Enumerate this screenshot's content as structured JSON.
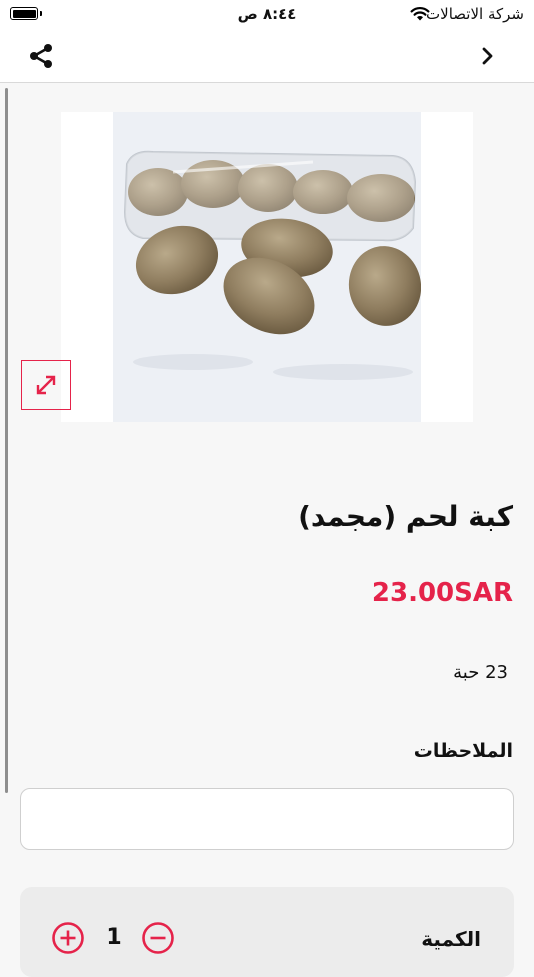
{
  "status_bar": {
    "carrier": "شركة الاتصالات",
    "time": "٨:٤٤ ص",
    "icons": [
      "battery-icon",
      "wifi-icon"
    ]
  },
  "nav": {
    "icons": [
      "share-icon",
      "chevron-right-icon"
    ]
  },
  "product": {
    "image_alt": "كبة لحم (مجمد)",
    "title": "كبة لحم (مجمد)",
    "price": "23.00SAR",
    "description": "23 حبة",
    "expand_icon": "expand-arrows-icon"
  },
  "notes": {
    "label": "الملاحظات",
    "value": "",
    "placeholder": ""
  },
  "quantity": {
    "label": "الكمية",
    "value": "1",
    "icons": [
      "plus-circle-icon",
      "minus-circle-icon"
    ]
  },
  "colors": {
    "accent": "#e5234a",
    "background": "#f7f7f7",
    "panel": "#ececec"
  }
}
